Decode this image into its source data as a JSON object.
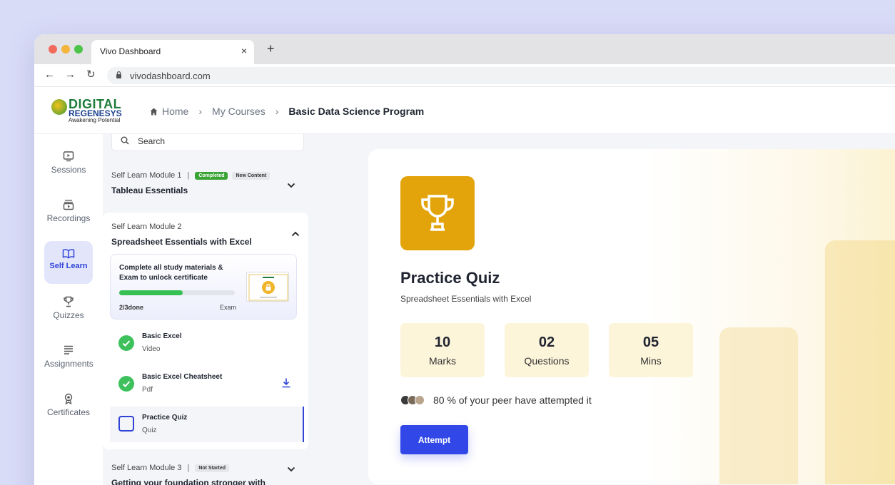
{
  "browser": {
    "tab_title": "Vivo Dashboard",
    "tab_close": "×",
    "new_tab": "+",
    "url": "vivodashboard.com",
    "back": "←",
    "forward": "→",
    "reload": "↻"
  },
  "brand": {
    "line1": "DIGITAL",
    "line2": "REGENESYS",
    "tagline": "Awakening Potential"
  },
  "breadcrumb": {
    "home": "Home",
    "courses": "My Courses",
    "current": "Basic Data Science Program",
    "sep": "›"
  },
  "nav": {
    "items": [
      {
        "label": "Sessions",
        "icon": "play-screen-icon"
      },
      {
        "label": "Recordings",
        "icon": "recordings-icon"
      },
      {
        "label": "Self Learn",
        "icon": "book-icon",
        "active": true
      },
      {
        "label": "Quizzes",
        "icon": "trophy-icon"
      },
      {
        "label": "Assignments",
        "icon": "list-icon"
      },
      {
        "label": "Certificates",
        "icon": "award-icon"
      }
    ]
  },
  "search": {
    "placeholder": "Search"
  },
  "modules": [
    {
      "number": "Self Learn Module 1",
      "title": "Tableau Essentials",
      "badges": [
        "Completed",
        "New Content"
      ]
    },
    {
      "number": "Self Learn Module 2",
      "title": "Spreadsheet Essentials with Excel",
      "certificate": {
        "text": "Complete all study materials & Exam to unlock certificate",
        "progress": "2/3done",
        "progress_fraction": 0.55,
        "next": "Exam"
      },
      "items": [
        {
          "title": "Basic Excel",
          "type": "Video",
          "status": "done"
        },
        {
          "title": "Basic Excel Cheatsheet",
          "type": "Pdf",
          "status": "done"
        },
        {
          "title": "Practice Quiz",
          "type": "Quiz",
          "status": "current"
        }
      ]
    },
    {
      "number": "Self Learn Module 3",
      "title": "Getting your foundation stronger with",
      "badges": [
        "Not Started"
      ]
    }
  ],
  "quiz": {
    "title": "Practice Quiz",
    "subtitle": "Spreadsheet Essentials with Excel",
    "stats": [
      {
        "value": "10",
        "label": "Marks"
      },
      {
        "value": "02",
        "label": "Questions"
      },
      {
        "value": "05",
        "label": "Mins"
      }
    ],
    "peers": "80 % of your peer have attempted it",
    "attempt_label": "Attempt"
  },
  "colors": {
    "accent": "#3247e8",
    "success": "#3ec15c",
    "trophy_bg": "#e3a40b",
    "stat_bg": "#fdf5da"
  }
}
